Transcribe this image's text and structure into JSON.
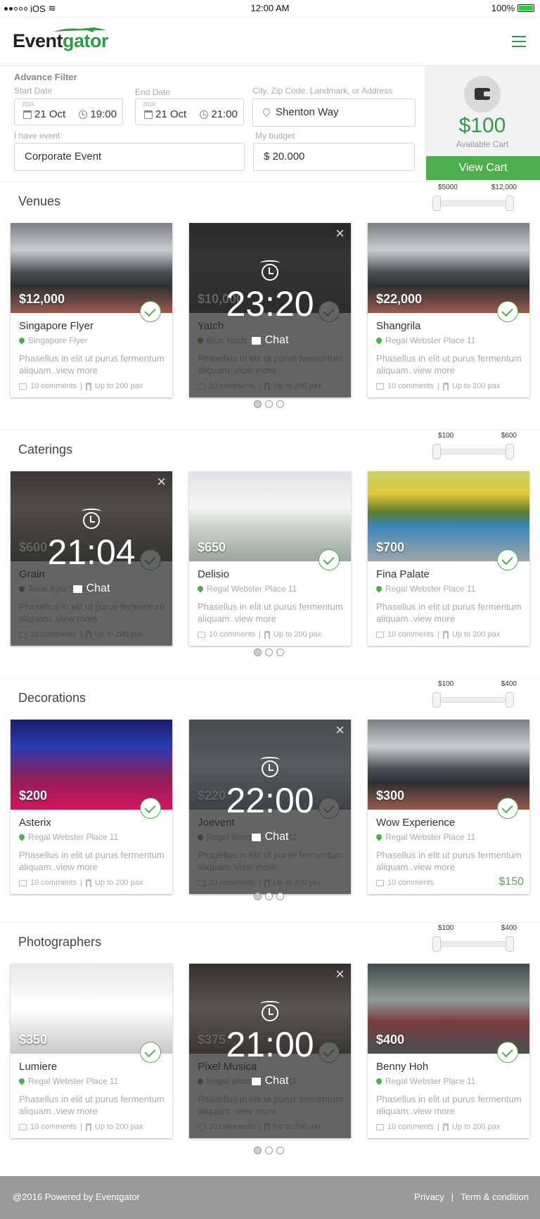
{
  "status": {
    "carrier": "iOS",
    "time": "12:00 AM",
    "battery": "100%"
  },
  "header": {
    "logo_a": "Event",
    "logo_b": "gator"
  },
  "filter": {
    "title": "Advance Filter",
    "start_label": "Start Date",
    "start_year": "2016",
    "start_date": "21 Oct",
    "start_time": "19:00",
    "end_label": "End Date",
    "end_year": "2016",
    "end_date": "21 Oct",
    "end_time": "21:00",
    "city_label": "City, Zip Code, Landmark, or Address",
    "city_value": "Shenton Way",
    "event_label": "I have event",
    "event_value": "Corporate Event",
    "budget_label": "My budget",
    "budget_value": "$ 20.000"
  },
  "cart": {
    "amount": "$100",
    "label": "Available Cart",
    "button": "View Cart"
  },
  "sections": [
    {
      "title": "Venues",
      "min": "$5000",
      "max": "$12,000",
      "cards": [
        {
          "price": "$12,000",
          "name": "Singapore Flyer",
          "location": "Singapore Flyer",
          "desc": "Phasellus in elit ut purus fermentum aliquam..view more",
          "comments": "10 comments",
          "pax": "Up to 200 pax"
        },
        {
          "price": "$10,000",
          "name": "Yatch",
          "location": "Blue Yatch",
          "desc": "Phasellus in elit ut purus fermentum aliquam..view more",
          "comments": "10 comments",
          "pax": "Up to 200 pax",
          "timer": "23:20",
          "chat": "Chat"
        },
        {
          "price": "$22,000",
          "name": "Shangrila",
          "location": "Regal Webster Place 11",
          "desc": "Phasellus in elit ut purus fermentum aliquam..view more",
          "comments": "10 comments",
          "pax": "Up to 200 pax"
        }
      ]
    },
    {
      "title": "Caterings",
      "min": "$100",
      "max": "$600",
      "cards": [
        {
          "price": "$600",
          "name": "Grain",
          "location": "Telok Ayer Street",
          "desc": "Phasellus in elit ut purus fermentum aliquam..view more",
          "comments": "10 comments",
          "pax": "Up to 200 pax",
          "timer": "21:04",
          "chat": "Chat"
        },
        {
          "price": "$650",
          "name": "Delisio",
          "location": "Regal Webster Place 11",
          "desc": "Phasellus in elit ut purus fermentum aliquam..view more",
          "comments": "10 comments",
          "pax": "Up to 200 pax"
        },
        {
          "price": "$700",
          "name": "Fina Palate",
          "location": "Regal Webster Place 11",
          "desc": "Phasellus in elit ut purus fermentum aliquam..view more",
          "comments": "10 comments",
          "pax": "Up to 200 pax"
        }
      ]
    },
    {
      "title": "Decorations",
      "min": "$100",
      "max": "$400",
      "cards": [
        {
          "price": "$200",
          "name": "Asterix",
          "location": "Regal Webster Place 11",
          "desc": "Phasellus in elit ut purus fermentum aliquam..view more",
          "comments": "10 comments",
          "pax": "Up to 200 pax"
        },
        {
          "price": "$220",
          "name": "Joevent",
          "location": "Regal Webster Place 11",
          "desc": "Phasellus in elit ut purus fermentum aliquam..view more",
          "comments": "10 comments",
          "pax": "Up to 200 pax",
          "timer": "22:00",
          "chat": "Chat"
        },
        {
          "price": "$300",
          "name": "Wow Experience",
          "location": "Regal Webster Place 11",
          "desc": "Phasellus in elit ut purus fermentum aliquam..view more",
          "comments": "10 comments",
          "extra_price": "$150"
        }
      ]
    },
    {
      "title": "Photographers",
      "min": "$100",
      "max": "$400",
      "cards": [
        {
          "price": "$350",
          "name": "Lumiere",
          "location": "Regal Webster Place 11",
          "desc": "Phasellus in elit ut purus fermentum aliquam..view more",
          "comments": "10 comments",
          "pax": "Up to 200 pax"
        },
        {
          "price": "$375",
          "name": "Pixel Musica",
          "location": "Regal Webster Place 11",
          "desc": "Phasellus in elit ut purus fermentum aliquam..view more",
          "comments": "10 comments",
          "pax": "Up to 200 pax",
          "timer": "21:00",
          "chat": "Chat"
        },
        {
          "price": "$400",
          "name": "Benny Hoh",
          "location": "Regal Webster Place 11",
          "desc": "Phasellus in elit ut purus fermentum aliquam..view more",
          "comments": "10 comments",
          "pax": "Up to 200 pax"
        }
      ]
    }
  ],
  "footer": {
    "copyright": "@2016 Powered by Eventgator",
    "privacy": "Privacy",
    "sep": "|",
    "terms": "Term & condition"
  }
}
